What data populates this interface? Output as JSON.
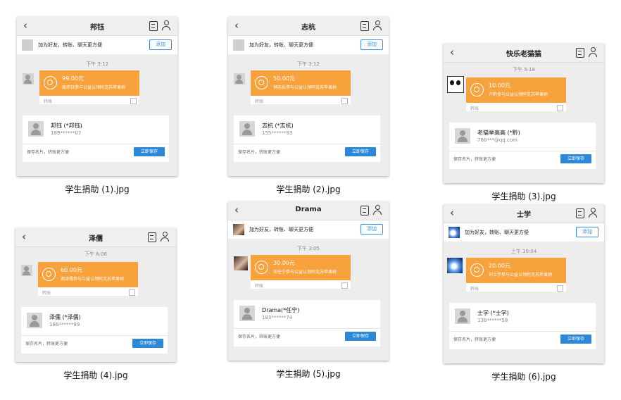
{
  "common": {
    "add_text": "加为好友，转账、聊天更方便",
    "add_button": "添加",
    "transfer_label": "转账",
    "save_text": "保存名片，转账更方便",
    "save_button": "立即保存",
    "back_glyph": "‹"
  },
  "items": [
    {
      "caption": "学生捐助 (1).jpg",
      "title": "邦钰",
      "time": "下午 3:12",
      "amount": "99.00元",
      "desc": "周邦钰参与公益认领阿克苏苹果树",
      "card_name": "邦钰 (*邦钰)",
      "card_num": "189******07",
      "has_add": true
    },
    {
      "caption": "学生捐助 (2).jpg",
      "title": "志杭",
      "time": "下午 3:12",
      "amount": "50.00元",
      "desc": "钟志杭参与公益认领阿克苏苹果树",
      "card_name": "志杭 (*志杭)",
      "card_num": "155******93",
      "has_add": true
    },
    {
      "caption": "学生捐助 (3).jpg",
      "title": "快乐老猫猫",
      "time": "下午 5:18",
      "amount": "10.00元",
      "desc": "卢黔参与公益认领阿克苏苹果树",
      "card_name": "老猫举高高 (*黔)",
      "card_num": "766***@qq.com",
      "has_add": false
    },
    {
      "caption": "学生捐助 (4).jpg",
      "title": "泽儒",
      "time": "下午 6:06",
      "amount": "60.00元",
      "desc": "谢泽儒参与公益认领阿克苏苹果树",
      "card_name": "泽儒 (*泽儒)",
      "card_num": "186******99",
      "has_add": false
    },
    {
      "caption": "学生捐助 (5).jpg",
      "title": "Drama",
      "time": "下午 3:05",
      "amount": "30.00元",
      "desc": "宋任宁参与公益认领阿克苏苹果树",
      "card_name": "Drama(*任宁)",
      "card_num": "183******74",
      "has_add": true
    },
    {
      "caption": "学生捐助 (6).jpg",
      "title": "士学",
      "time": "上午 10:04",
      "amount": "20.00元",
      "desc": "刘士学参与公益认领阿克苏苹果树",
      "card_name": "士学 (*士学)",
      "card_num": "136******58",
      "has_add": true
    }
  ],
  "avatar_styles": [
    "gray",
    "gray",
    "panda",
    "gray",
    "photo",
    "space"
  ]
}
